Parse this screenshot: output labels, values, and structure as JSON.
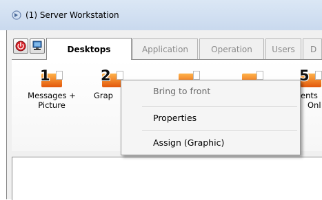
{
  "window": {
    "title": "(1)  Server Workstation",
    "app_icon": "app-signal-icon"
  },
  "toolbar": {
    "buttons": [
      {
        "icon": "power-red-icon"
      },
      {
        "icon": "monitor-network-icon"
      }
    ]
  },
  "tabs": [
    {
      "label": "Desktops",
      "active": true
    },
    {
      "label": "Application",
      "active": false
    },
    {
      "label": "Operation",
      "active": false
    },
    {
      "label": "Users",
      "active": false
    },
    {
      "label": "D",
      "active": false
    }
  ],
  "workstations": [
    {
      "number": "1",
      "label_line1": "Messages +",
      "label_line2": "Picture"
    },
    {
      "number": "2",
      "label_line1": "Grap",
      "label_line2": ""
    },
    {
      "number": "",
      "label_line1": "",
      "label_line2": ""
    },
    {
      "number": "",
      "label_line1": "",
      "label_line2": ""
    },
    {
      "number": "5",
      "label_line1": "ents",
      "label_line2": "Onl"
    }
  ],
  "context_menu": {
    "items": [
      {
        "label": "Bring to front",
        "enabled": false
      },
      {
        "label": "Properties",
        "enabled": true
      },
      {
        "label": "Assign  (Graphic)",
        "enabled": true
      }
    ]
  },
  "colors": {
    "titlebar": "#dbe7f5",
    "tile_orange": "#e2570b",
    "menu_bg": "#f5f5f5"
  }
}
